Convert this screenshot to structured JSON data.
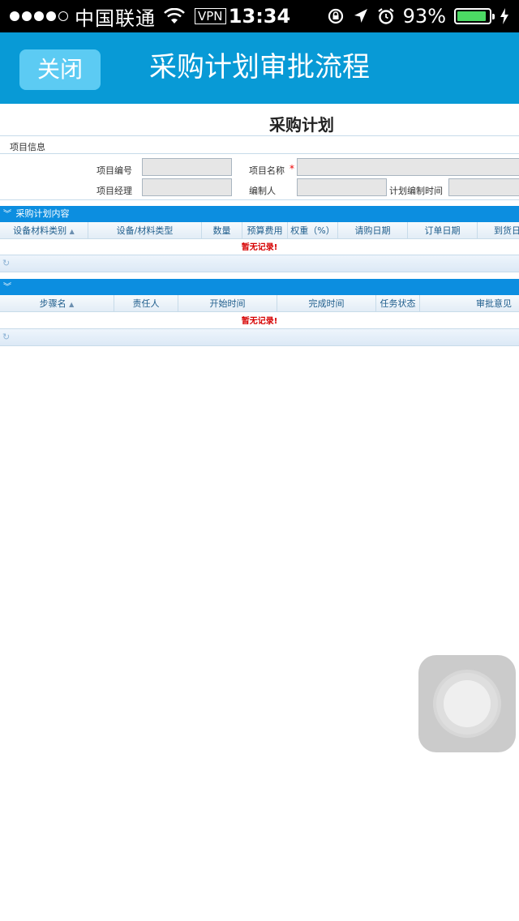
{
  "status_bar": {
    "carrier": "中国联通",
    "vpn": "VPN",
    "time": "13:34",
    "battery_percent": "93%",
    "battery_level": 0.93,
    "signal_bars_filled": 4,
    "signal_bars_total": 5,
    "battery_color": "#4cd964"
  },
  "header": {
    "close_label": "关闭",
    "title": "采购计划审批流程",
    "background": "#089ad6"
  },
  "document": {
    "title": "采购计划",
    "section_label": "项目信息",
    "fields": {
      "project_no_label": "项目编号",
      "project_name_label": "项目名称",
      "project_manager_label": "项目经理",
      "editor_label": "编制人",
      "plan_time_label": "计划编制时间",
      "required_mark": "*",
      "project_no_value": "",
      "project_name_value": "",
      "project_manager_value": "",
      "editor_value": "",
      "plan_time_value": ""
    },
    "plan_panel": {
      "title": "采购计划内容",
      "columns": [
        "设备材料类别",
        "设备/材料类型",
        "数量",
        "预算费用",
        "权重（%）",
        "请购日期",
        "订单日期",
        "到货日"
      ],
      "empty_message": "暂无记录!"
    },
    "steps_panel": {
      "title": "",
      "columns": [
        "步骤名",
        "责任人",
        "开始时间",
        "完成时间",
        "任务状态",
        "审批意见"
      ],
      "empty_message": "暂无记录!"
    }
  }
}
